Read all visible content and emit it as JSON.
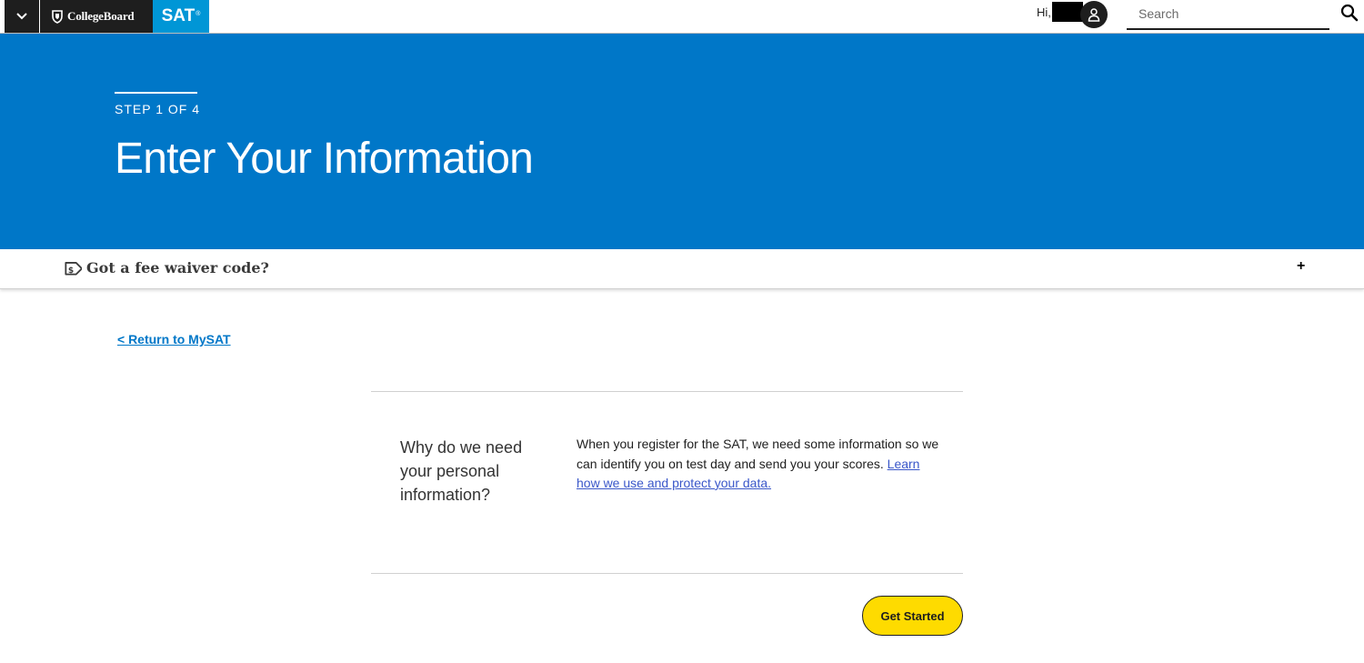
{
  "header": {
    "logo_collegeboard": "CollegeBoard",
    "logo_sat": "SAT",
    "logo_sat_mark": "®",
    "greeting": "Hi,",
    "search_placeholder": "Search",
    "icons": {
      "menu": "chevron-down-icon",
      "logo": "acorn-shield-icon",
      "avatar": "user-icon",
      "search": "search-icon"
    }
  },
  "hero": {
    "step_label": "STEP 1 OF 4",
    "title": "Enter Your Information"
  },
  "fee_waiver": {
    "label": "Got a fee waiver code?",
    "expand_symbol": "+",
    "icon": "price-tag-dollar-icon"
  },
  "return_link": "< Return to MySAT",
  "info": {
    "question": "Why do we need your personal information?",
    "body": "When you register for the SAT, we need some information so we can identify you on test day and send you your scores. ",
    "link": "Learn how we use and protect your data."
  },
  "actions": {
    "get_started": "Get Started"
  },
  "colors": {
    "hero_blue": "#0077c8",
    "sat_blue": "#0096d6",
    "button_yellow": "#fedb00",
    "link_blue": "#3a57c9"
  }
}
